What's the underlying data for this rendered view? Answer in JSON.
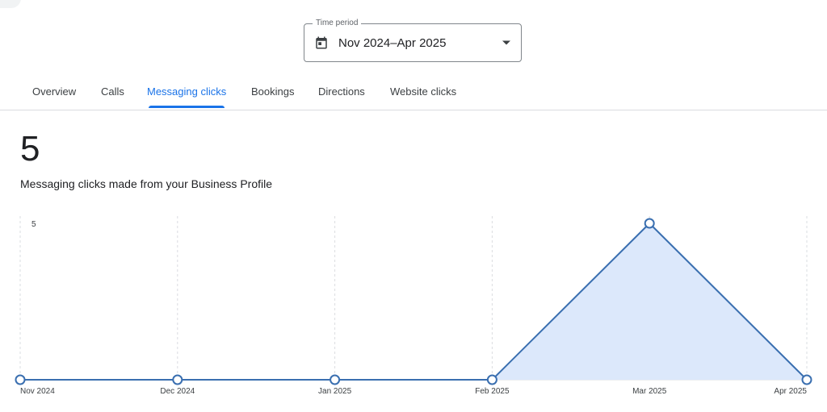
{
  "time_period": {
    "label": "Time period",
    "value": "Nov 2024–Apr 2025",
    "icon": "calendar-icon",
    "dropdown_icon": "dropdown-arrow-icon"
  },
  "tabs": [
    {
      "label": "Overview",
      "active": false
    },
    {
      "label": "Calls",
      "active": false
    },
    {
      "label": "Messaging clicks",
      "active": true
    },
    {
      "label": "Bookings",
      "active": false
    },
    {
      "label": "Directions",
      "active": false
    },
    {
      "label": "Website clicks",
      "active": false
    }
  ],
  "summary": {
    "total": "5",
    "description": "Messaging clicks made from your Business Profile"
  },
  "colors": {
    "accent": "#1a73e8",
    "line": "#3a6fb0",
    "area_fill": "#dce8fb"
  },
  "chart_data": {
    "type": "area",
    "categories": [
      "Nov 2024",
      "Dec 2024",
      "Jan 2025",
      "Feb 2025",
      "Mar 2025",
      "Apr 2025"
    ],
    "values": [
      0,
      0,
      0,
      0,
      5,
      0
    ],
    "ylim": [
      0,
      5
    ],
    "yticks": [
      5
    ],
    "grid": true,
    "markers": true
  }
}
